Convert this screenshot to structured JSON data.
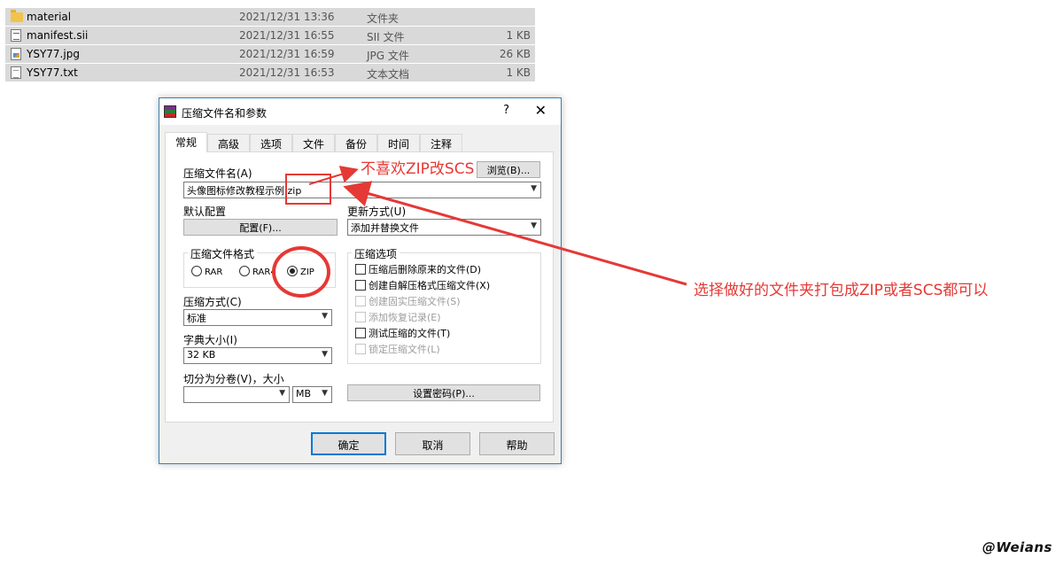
{
  "files": [
    {
      "name": "material",
      "date": "2021/12/31 13:36",
      "type": "文件夹",
      "size": "",
      "icon": "folder-icon"
    },
    {
      "name": "manifest.sii",
      "date": "2021/12/31 16:55",
      "type": "SII 文件",
      "size": "1 KB",
      "icon": "sii-file-icon"
    },
    {
      "name": "YSY77.jpg",
      "date": "2021/12/31 16:59",
      "type": "JPG 文件",
      "size": "26 KB",
      "icon": "jpg-file-icon"
    },
    {
      "name": "YSY77.txt",
      "date": "2021/12/31 16:53",
      "type": "文本文档",
      "size": "1 KB",
      "icon": "txt-file-icon"
    }
  ],
  "dialog": {
    "title": "压缩文件名和参数",
    "help": "?",
    "close": "✕",
    "tabs": [
      "常规",
      "高级",
      "选项",
      "文件",
      "备份",
      "时间",
      "注释"
    ],
    "archive_name_label": "压缩文件名(A)",
    "archive_name_value": "头像图标修改教程示例.zip",
    "browse_button": "浏览(B)...",
    "default_profile_label": "默认配置",
    "profiles_button": "配置(F)...",
    "update_mode_label": "更新方式(U)",
    "update_mode_value": "添加并替换文件",
    "format_group": "压缩文件格式",
    "formats": [
      "RAR",
      "RAR4",
      "ZIP"
    ],
    "selected_format": "ZIP",
    "method_label": "压缩方式(C)",
    "method_value": "标准",
    "dict_label": "字典大小(I)",
    "dict_value": "32 KB",
    "split_label": "切分为分卷(V)，大小",
    "split_value": "",
    "split_unit": "MB",
    "options_group": "压缩选项",
    "options": [
      {
        "label": "压缩后删除原来的文件(D)",
        "enabled": true,
        "checked": false
      },
      {
        "label": "创建自解压格式压缩文件(X)",
        "enabled": true,
        "checked": false
      },
      {
        "label": "创建固实压缩文件(S)",
        "enabled": false,
        "checked": false
      },
      {
        "label": "添加恢复记录(E)",
        "enabled": false,
        "checked": false
      },
      {
        "label": "测试压缩的文件(T)",
        "enabled": true,
        "checked": false
      },
      {
        "label": "锁定压缩文件(L)",
        "enabled": false,
        "checked": false
      }
    ],
    "password_button": "设置密码(P)...",
    "ok_button": "确定",
    "cancel_button": "取消",
    "help_button": "帮助"
  },
  "annotations": {
    "note_top": "不喜欢ZIP改SCS",
    "note_right": "选择做好的文件夹打包成ZIP或者SCS都可以",
    "color": "#e53935"
  },
  "watermark": "@Weians"
}
